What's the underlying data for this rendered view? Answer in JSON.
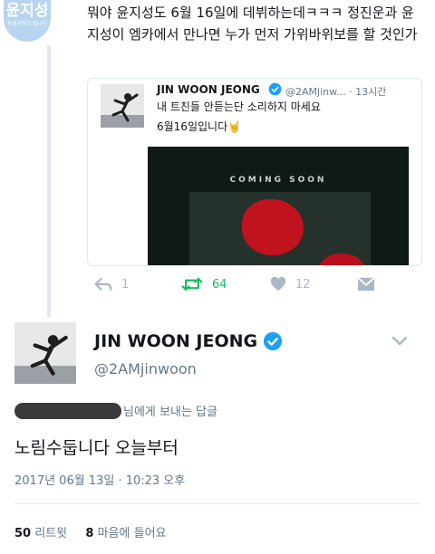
{
  "top_tweet": {
    "avatar_text": "윤지성",
    "avatar_subtext": "투표부탁드립니다",
    "text": "뭐야 윤지성도 6월 16일에 데뷔하는데ㅋㅋㅋ 정진운과 윤지성이 엠카에서 만나면 누가 먼저 가위바위보를 할 것인가"
  },
  "quoted_tweet": {
    "name": "JIN WOON JEONG",
    "handle": "@2AMjinw...",
    "time": "· 13시간",
    "line1": "내 트친들 안듣는단 소리하지 마세요",
    "line2": "6월16일입니다🤘",
    "media_caption": "COMING SOON"
  },
  "actions": {
    "reply_count": "1",
    "retweet_count": "64",
    "like_count": "12"
  },
  "main_tweet": {
    "name": "JIN WOON JEONG",
    "handle": "@2AMjinwoon",
    "reply_to_suffix": "님에게 보내는 답글",
    "text": "노림수둡니다 오늘부터",
    "timestamp": "2017년 06월 13일 · 10:23 오후",
    "retweets_count": "50",
    "retweets_label": "리트윗",
    "likes_count": "8",
    "likes_label": "마음에 들어요"
  },
  "icons": {
    "verified": "verified-badge-icon",
    "reply": "reply-icon",
    "retweet": "retweet-icon",
    "like": "heart-icon",
    "dm": "envelope-icon",
    "more": "chevron-down-icon"
  },
  "colors": {
    "retweet_active": "#17bf63",
    "verified": "#1da1f2",
    "muted": "#657786"
  }
}
